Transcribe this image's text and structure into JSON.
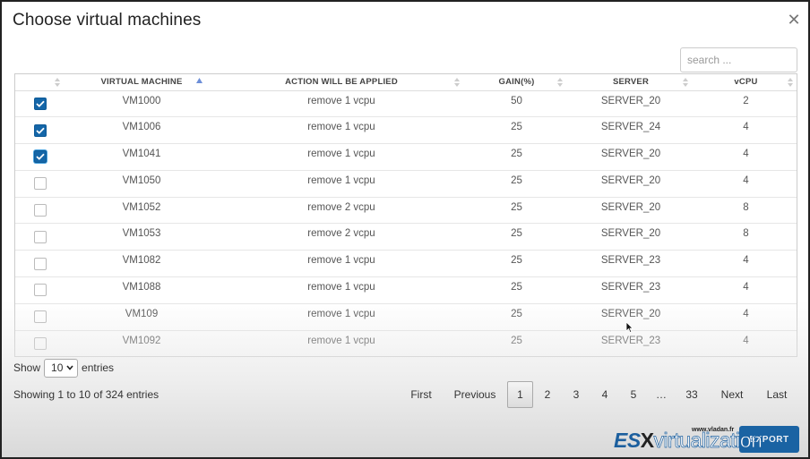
{
  "dialog": {
    "title": "Choose virtual machines",
    "close_glyph": "✕"
  },
  "search": {
    "placeholder": "search ..."
  },
  "table": {
    "columns": [
      {
        "label": "",
        "sort": "none"
      },
      {
        "label": "VIRTUAL MACHINE",
        "sort": "ascending"
      },
      {
        "label": "ACTION WILL BE APPLIED",
        "sort": "none"
      },
      {
        "label": "GAIN(%)",
        "sort": "none"
      },
      {
        "label": "SERVER",
        "sort": "none"
      },
      {
        "label": "vCPU",
        "sort": "none"
      }
    ],
    "rows": [
      {
        "checked": true,
        "vm": "VM1000",
        "action": "remove 1 vcpu",
        "gain": "50",
        "server": "SERVER_20",
        "vcpu": "2"
      },
      {
        "checked": true,
        "vm": "VM1006",
        "action": "remove 1 vcpu",
        "gain": "25",
        "server": "SERVER_24",
        "vcpu": "4"
      },
      {
        "checked": true,
        "vm": "VM1041",
        "action": "remove 1 vcpu",
        "gain": "25",
        "server": "SERVER_20",
        "vcpu": "4"
      },
      {
        "checked": false,
        "vm": "VM1050",
        "action": "remove 1 vcpu",
        "gain": "25",
        "server": "SERVER_20",
        "vcpu": "4"
      },
      {
        "checked": false,
        "vm": "VM1052",
        "action": "remove 2 vcpu",
        "gain": "25",
        "server": "SERVER_20",
        "vcpu": "8"
      },
      {
        "checked": false,
        "vm": "VM1053",
        "action": "remove 2 vcpu",
        "gain": "25",
        "server": "SERVER_20",
        "vcpu": "8"
      },
      {
        "checked": false,
        "vm": "VM1082",
        "action": "remove 1 vcpu",
        "gain": "25",
        "server": "SERVER_23",
        "vcpu": "4"
      },
      {
        "checked": false,
        "vm": "VM1088",
        "action": "remove 1 vcpu",
        "gain": "25",
        "server": "SERVER_23",
        "vcpu": "4"
      },
      {
        "checked": false,
        "vm": "VM109",
        "action": "remove 1 vcpu",
        "gain": "25",
        "server": "SERVER_20",
        "vcpu": "4"
      },
      {
        "checked": false,
        "vm": "VM1092",
        "action": "remove 1 vcpu",
        "gain": "25",
        "server": "SERVER_23",
        "vcpu": "4"
      }
    ]
  },
  "length_menu": {
    "prefix": "Show",
    "selected": "10",
    "suffix": "entries"
  },
  "info": "Showing 1 to 10 of 324 entries",
  "pagination": {
    "first": "First",
    "previous": "Previous",
    "pages": [
      "1",
      "2",
      "3",
      "4",
      "5",
      "…",
      "33"
    ],
    "current": "1",
    "next": "Next",
    "last": "Last"
  },
  "export_label": "EXPORT",
  "watermark": {
    "url": "www.vladan.fr",
    "brand_es": "ES",
    "brand_x": "X",
    "brand_rest": "virtualization"
  },
  "colors": {
    "accent": "#1466a8",
    "export_button": "#1a63a3"
  }
}
